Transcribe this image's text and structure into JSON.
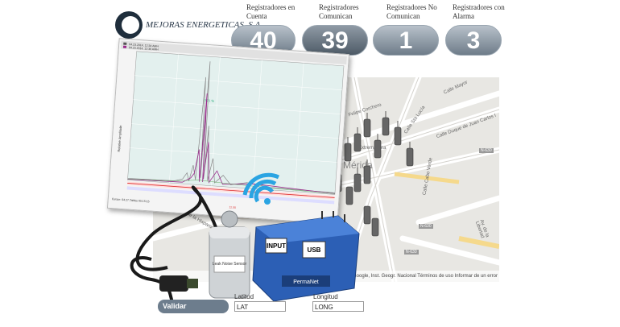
{
  "logo": {
    "text": "MEJORAS ENERGETICAS, S.A."
  },
  "stats": [
    {
      "label": "Registradores en Cuenta",
      "value": "40"
    },
    {
      "label": "Registradores Comunican",
      "value": "39"
    },
    {
      "label": "Registradores No Comunican",
      "value": "1"
    },
    {
      "label": "Registradores con Alarma",
      "value": "3"
    }
  ],
  "map": {
    "streets": [
      "Calle Mayor",
      "Felipe Corchero",
      "Calle Sta Lucía",
      "Calle Duque de Juan Carlos I",
      "Extremadura",
      "Mérida",
      "Av. de la Hispanidad",
      "Av. de la Libertad",
      "Calle Cabo Verde"
    ],
    "roads": [
      "N-630",
      "N-630",
      "N-630"
    ],
    "footer": "Google, Inst. Geogr. Nacional    Términos de uso    Informar de un error de"
  },
  "chart": {
    "ylabel": "Relative Amplitude",
    "legend": [
      "04.23.2014, 12:34 AMH",
      "04.23.2014, 12:36 AMH"
    ],
    "peak_label": "0.21 %",
    "footer_left": "Cursor: 04.27.Tables 05:15:15",
    "footer_mid": "11.50"
  },
  "devices": {
    "sensor_label": "Leak Noise Sensor",
    "box_input": "INPUT",
    "box_usb": "USB",
    "box_brand": "PermaNet"
  },
  "bottom": {
    "button": "Validar Coordenadas",
    "lat_label": "Latitud",
    "lat_value": "LAT",
    "long_label": "Longitud",
    "long_value": "LONG"
  }
}
